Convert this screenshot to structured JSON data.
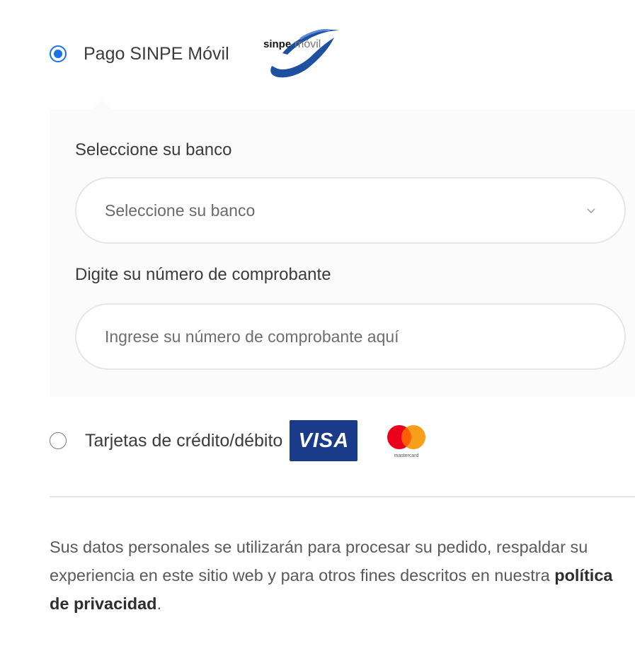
{
  "payment": {
    "sinpe": {
      "label": "Pago SINPE Móvil",
      "selected": true,
      "logo": {
        "icon": "sinpe-movil-logo",
        "text_bold": "sinpe",
        "text_light": "móvil"
      }
    },
    "cards": {
      "label": "Tarjetas de crédito/débito",
      "selected": false,
      "visa_text": "VISA",
      "mastercard_text": "mastercard"
    }
  },
  "form": {
    "bank_label": "Seleccione su banco",
    "bank_select_value": "Seleccione su banco",
    "voucher_label": "Digite su número de comprobante",
    "voucher_placeholder": "Ingrese su número de comprobante aquí"
  },
  "privacy": {
    "text_before": "Sus datos personales se utilizarán para procesar su pedido, respaldar su experiencia en este sitio web y para otros fines descritos en nuestra ",
    "link_text": "política de privacidad",
    "text_after": "."
  },
  "colors": {
    "radio_active": "#1a73e8",
    "visa_bg": "#1a3a8a",
    "mc_red": "#eb001b",
    "mc_orange": "#f79e1b",
    "sinpe_blue": "#1e4fa0",
    "panel_bg": "#fbfbfb",
    "border": "#e6e6e6"
  }
}
